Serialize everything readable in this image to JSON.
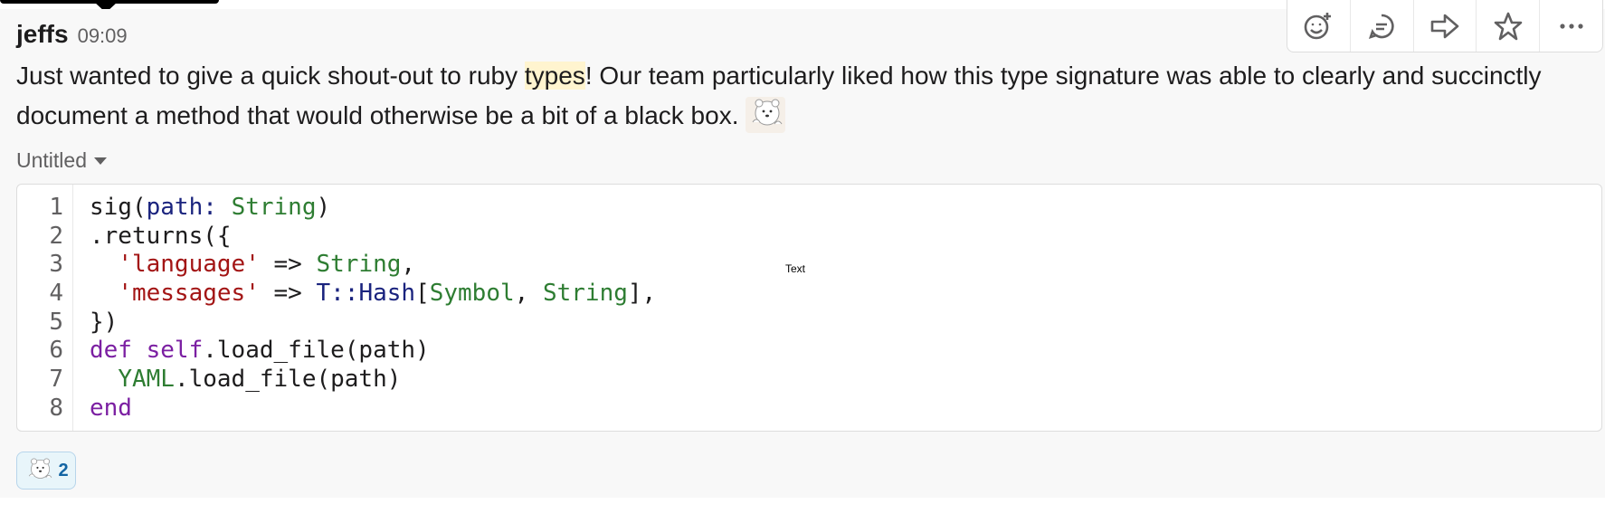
{
  "message": {
    "username": "jeffs",
    "timestamp": "09:09",
    "text_before": "Just wanted to give a quick shout-out to ruby ",
    "text_highlight": "types",
    "text_after": "! Our team particularly liked how this type signature was able to clearly and succinctly document a method that would otherwise be a bit of a black box. ",
    "emoji_name": "bear-peeking-icon"
  },
  "actions": [
    {
      "icon": "add-reaction-icon"
    },
    {
      "icon": "reply-thread-icon"
    },
    {
      "icon": "share-icon"
    },
    {
      "icon": "star-icon"
    },
    {
      "icon": "more-icon"
    }
  ],
  "snippet": {
    "title": "Untitled",
    "line_numbers": [
      "1",
      "2",
      "3",
      "4",
      "5",
      "6",
      "7",
      "8"
    ],
    "lines": [
      [
        {
          "t": "sig(",
          "c": ""
        },
        {
          "t": "path:",
          "c": "k-blue"
        },
        {
          "t": " ",
          "c": ""
        },
        {
          "t": "String",
          "c": "k-type"
        },
        {
          "t": ")",
          "c": ""
        }
      ],
      [
        {
          "t": ".returns({",
          "c": ""
        }
      ],
      [
        {
          "t": "  ",
          "c": ""
        },
        {
          "t": "'language'",
          "c": "k-str"
        },
        {
          "t": " => ",
          "c": ""
        },
        {
          "t": "String",
          "c": "k-type"
        },
        {
          "t": ",",
          "c": ""
        }
      ],
      [
        {
          "t": "  ",
          "c": ""
        },
        {
          "t": "'messages'",
          "c": "k-str"
        },
        {
          "t": " => ",
          "c": ""
        },
        {
          "t": "T::Hash",
          "c": "k-blue"
        },
        {
          "t": "[",
          "c": ""
        },
        {
          "t": "Symbol",
          "c": "k-type"
        },
        {
          "t": ", ",
          "c": ""
        },
        {
          "t": "String",
          "c": "k-type"
        },
        {
          "t": "],",
          "c": ""
        }
      ],
      [
        {
          "t": "})",
          "c": ""
        }
      ],
      [
        {
          "t": "def",
          "c": "k-kw"
        },
        {
          "t": " ",
          "c": ""
        },
        {
          "t": "self",
          "c": "k-kw"
        },
        {
          "t": ".load_file(path)",
          "c": ""
        }
      ],
      [
        {
          "t": "  ",
          "c": ""
        },
        {
          "t": "YAML",
          "c": "k-type"
        },
        {
          "t": ".load_file(path)",
          "c": ""
        }
      ],
      [
        {
          "t": "end",
          "c": "k-kw"
        }
      ]
    ]
  },
  "floating_label": "Text",
  "reaction": {
    "emoji_name": "bear-peeking-icon",
    "count": "2"
  },
  "colors": {
    "highlight": "#fff4cf",
    "string": "#a31515",
    "type": "#2e7d32",
    "keyword": "#7b1fa2",
    "reaction_border": "#b7d5eb",
    "reaction_count": "#1264a3"
  }
}
